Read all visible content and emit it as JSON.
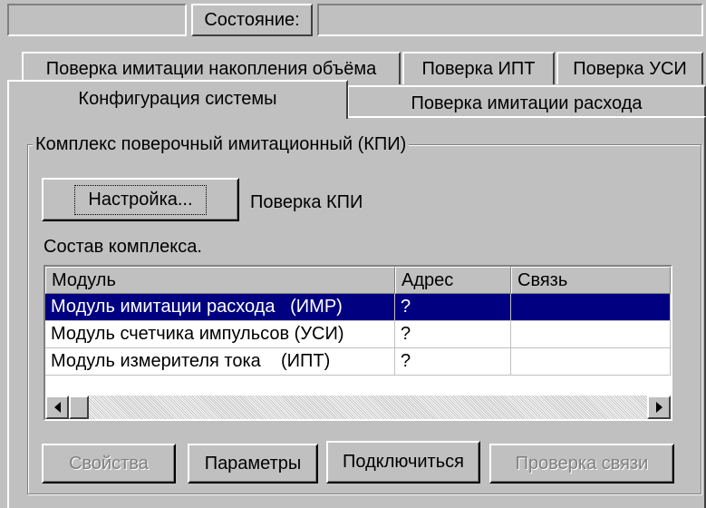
{
  "status_bar": {
    "label": "Состояние:",
    "value": ""
  },
  "tabs": {
    "row_back": [
      {
        "label": "Поверка имитации накопления объёма"
      },
      {
        "label": "Поверка ИПТ"
      },
      {
        "label": "Поверка УСИ"
      }
    ],
    "row_front": [
      {
        "label": "Конфигурация системы",
        "active": true
      },
      {
        "label": "Поверка имитации расхода"
      }
    ]
  },
  "group": {
    "title": "Комплекс поверочный имитационный (КПИ)",
    "setup_button": "Настройка...",
    "setup_caption": "Поверка КПИ",
    "composition_label": "Состав комплекса."
  },
  "table": {
    "columns": [
      "Модуль",
      "Адрес",
      "Связь"
    ],
    "rows": [
      {
        "module": "Модуль имитации расхода   (ИМР)",
        "address": "?",
        "link": "",
        "selected": true
      },
      {
        "module": "Модуль счетчика импульсов (УСИ)",
        "address": "?",
        "link": ""
      },
      {
        "module": "Модуль измерителя тока    (ИПТ)",
        "address": "?",
        "link": ""
      }
    ]
  },
  "buttons": {
    "properties": {
      "label": "Свойства",
      "enabled": false
    },
    "parameters": {
      "label": "Параметры",
      "enabled": true
    },
    "connect": {
      "label": "Подключиться",
      "enabled": true
    },
    "check_link": {
      "label": "Проверка связи",
      "enabled": false
    }
  },
  "colors": {
    "face": "#c0c0c0",
    "selection": "#000080",
    "selection_text": "#ffffff",
    "disabled_text": "#808080"
  },
  "icons": {
    "scroll_left": "arrow-left-icon",
    "scroll_right": "arrow-right-icon"
  }
}
